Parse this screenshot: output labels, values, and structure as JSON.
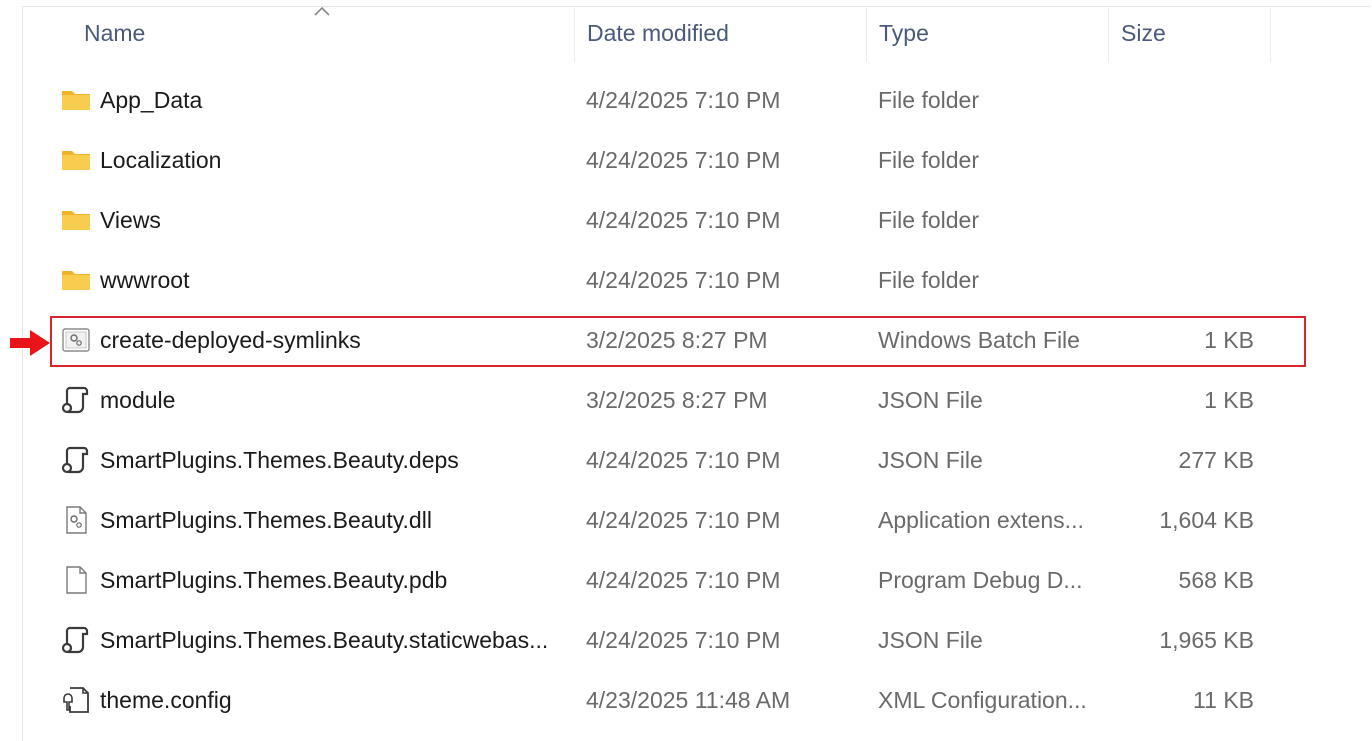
{
  "columns": {
    "name": "Name",
    "date_modified": "Date modified",
    "type": "Type",
    "size": "Size"
  },
  "files": [
    {
      "name": "App_Data",
      "date": "4/24/2025 7:10 PM",
      "type": "File folder",
      "size": "",
      "icon": "folder-icon"
    },
    {
      "name": "Localization",
      "date": "4/24/2025 7:10 PM",
      "type": "File folder",
      "size": "",
      "icon": "folder-icon"
    },
    {
      "name": "Views",
      "date": "4/24/2025 7:10 PM",
      "type": "File folder",
      "size": "",
      "icon": "folder-icon"
    },
    {
      "name": "wwwroot",
      "date": "4/24/2025 7:10 PM",
      "type": "File folder",
      "size": "",
      "icon": "folder-icon"
    },
    {
      "name": "create-deployed-symlinks",
      "date": "3/2/2025 8:27 PM",
      "type": "Windows Batch File",
      "size": "1 KB",
      "icon": "batch-file-icon"
    },
    {
      "name": "module",
      "date": "3/2/2025 8:27 PM",
      "type": "JSON File",
      "size": "1 KB",
      "icon": "json-file-icon"
    },
    {
      "name": "SmartPlugins.Themes.Beauty.deps",
      "date": "4/24/2025 7:10 PM",
      "type": "JSON File",
      "size": "277 KB",
      "icon": "json-file-icon"
    },
    {
      "name": "SmartPlugins.Themes.Beauty.dll",
      "date": "4/24/2025 7:10 PM",
      "type": "Application extens...",
      "size": "1,604 KB",
      "icon": "dll-file-icon"
    },
    {
      "name": "SmartPlugins.Themes.Beauty.pdb",
      "date": "4/24/2025 7:10 PM",
      "type": "Program Debug D...",
      "size": "568 KB",
      "icon": "blank-file-icon"
    },
    {
      "name": "SmartPlugins.Themes.Beauty.staticwebas...",
      "date": "4/24/2025 7:10 PM",
      "type": "JSON File",
      "size": "1,965 KB",
      "icon": "json-file-icon"
    },
    {
      "name": "theme.config",
      "date": "4/23/2025 11:48 AM",
      "type": "XML Configuration...",
      "size": "11 KB",
      "icon": "config-file-icon"
    }
  ],
  "colors": {
    "highlight": "#d9262c",
    "folder": "#f5c343",
    "header_text": "#4a5a7a"
  }
}
